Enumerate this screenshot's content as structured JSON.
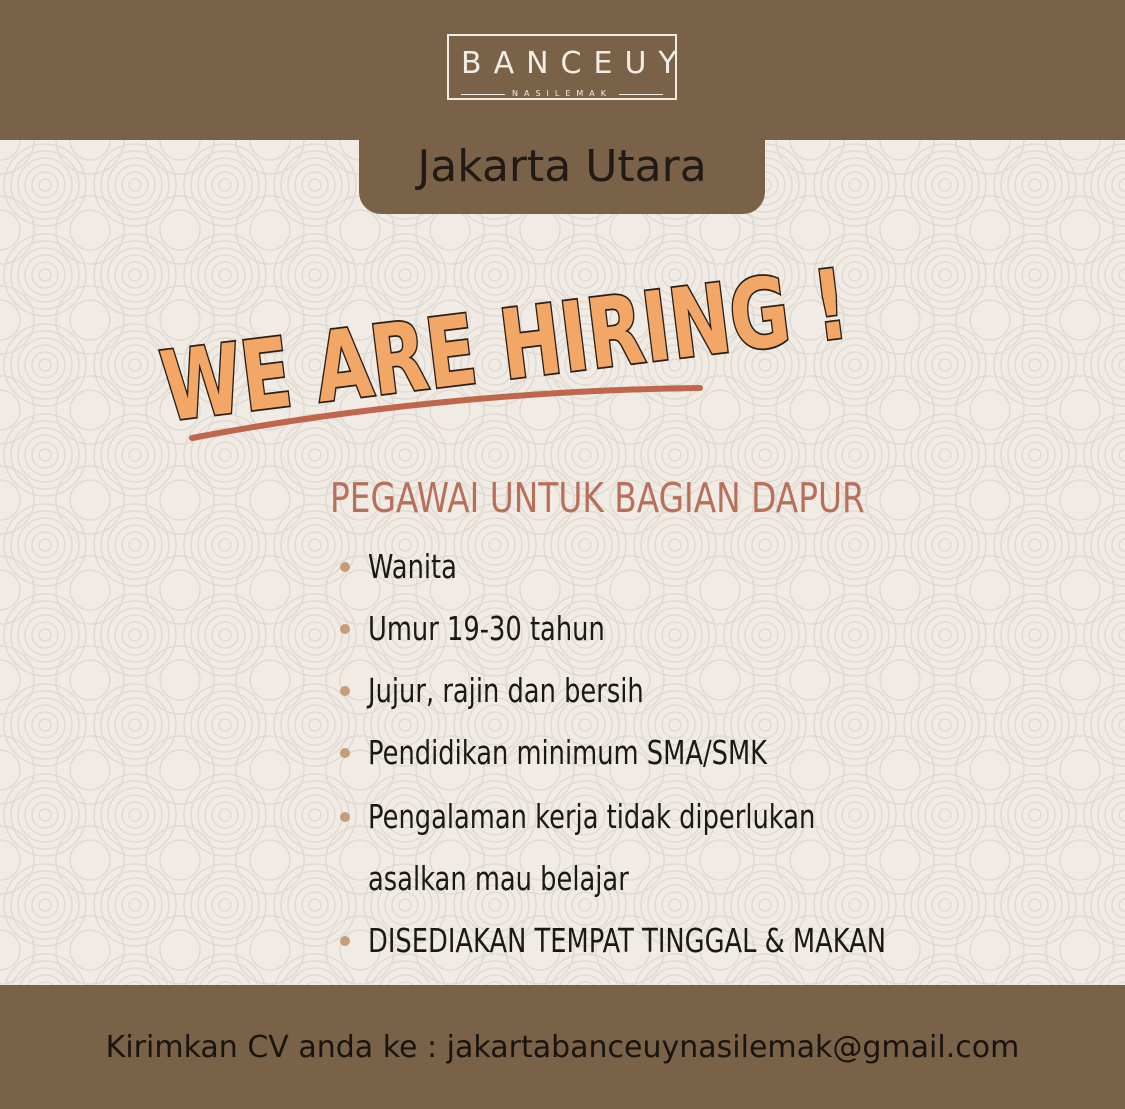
{
  "brand": {
    "name": "BANCEUY",
    "subtitle": "NASILEMAK"
  },
  "location": "Jakarta Utara",
  "headline": "WE ARE HIRING !",
  "position_title": "PEGAWAI UNTUK BAGIAN DAPUR",
  "requirements": [
    "Wanita",
    "Umur  19-30 tahun",
    "Jujur, rajin dan bersih",
    "Pendidikan minimum SMA/SMK",
    "Pengalaman kerja tidak diperlukan",
    "asalkan mau belajar",
    "DISEDIAKAN TEMPAT TINGGAL & MAKAN"
  ],
  "footer": "Kirimkan CV anda ke : jakartabanceuynasilemak@gmail.com",
  "colors": {
    "band": "#7a6249",
    "background": "#f0ece5",
    "headline_fill": "#f2a766",
    "headline_outline": "#2a1e16",
    "accent": "#b8705a",
    "bullet": "#c79d78"
  }
}
